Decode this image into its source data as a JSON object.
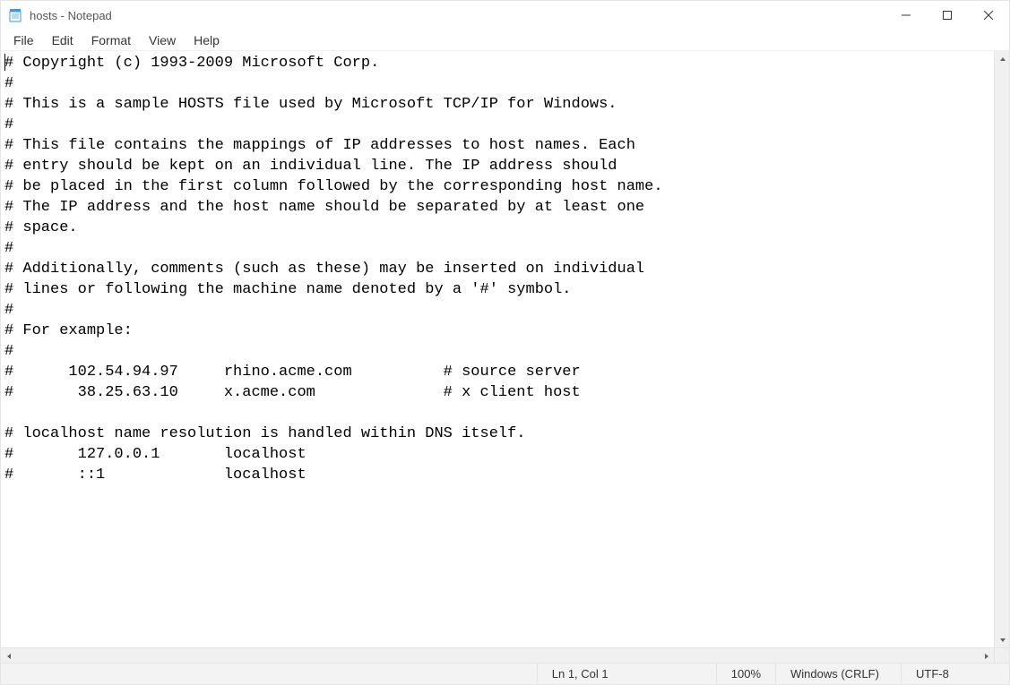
{
  "window": {
    "title": "hosts - Notepad"
  },
  "menu": {
    "items": [
      "File",
      "Edit",
      "Format",
      "View",
      "Help"
    ]
  },
  "editor": {
    "content": "# Copyright (c) 1993-2009 Microsoft Corp.\n#\n# This is a sample HOSTS file used by Microsoft TCP/IP for Windows.\n#\n# This file contains the mappings of IP addresses to host names. Each\n# entry should be kept on an individual line. The IP address should\n# be placed in the first column followed by the corresponding host name.\n# The IP address and the host name should be separated by at least one\n# space.\n#\n# Additionally, comments (such as these) may be inserted on individual\n# lines or following the machine name denoted by a '#' symbol.\n#\n# For example:\n#\n#      102.54.94.97     rhino.acme.com          # source server\n#       38.25.63.10     x.acme.com              # x client host\n\n# localhost name resolution is handled within DNS itself.\n#\t127.0.0.1       localhost\n#\t::1             localhost\n"
  },
  "status": {
    "position": "Ln 1, Col 1",
    "zoom": "100%",
    "line_ending": "Windows (CRLF)",
    "encoding": "UTF-8"
  }
}
